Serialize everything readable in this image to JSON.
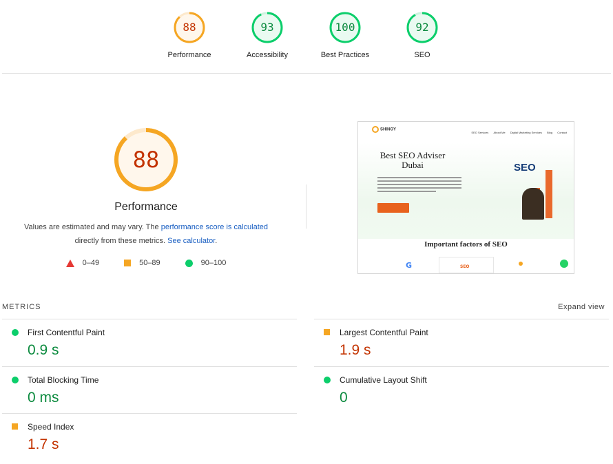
{
  "top_scores": [
    {
      "label": "Performance",
      "score": "88",
      "level": "average"
    },
    {
      "label": "Accessibility",
      "score": "93",
      "level": "good"
    },
    {
      "label": "Best Practices",
      "score": "100",
      "level": "good"
    },
    {
      "label": "SEO",
      "score": "92",
      "level": "good"
    }
  ],
  "performance": {
    "score": "88",
    "title": "Performance",
    "desc_prefix": "Values are estimated and may vary. The ",
    "desc_link1": "performance score is calculated",
    "desc_middle": "directly from these metrics. ",
    "desc_link2": "See calculator",
    "desc_suffix": "."
  },
  "legend": {
    "poor": "0–49",
    "average": "50–89",
    "good": "90–100"
  },
  "screenshot": {
    "logo_text": "SHINOY",
    "menu": [
      "SEO Services",
      "About Me",
      "Digital Marketing Services",
      "Blog",
      "Contact"
    ],
    "hero_title": "Best SEO Adviser Dubai",
    "seo_graphic": "SEO",
    "section_title": "Important factors of SEO"
  },
  "metrics": {
    "heading": "METRICS",
    "expand": "Expand view",
    "items": [
      {
        "name": "First Contentful Paint",
        "value": "0.9 s",
        "level": "good"
      },
      {
        "name": "Largest Contentful Paint",
        "value": "1.9 s",
        "level": "average"
      },
      {
        "name": "Total Blocking Time",
        "value": "0 ms",
        "level": "good"
      },
      {
        "name": "Cumulative Layout Shift",
        "value": "0",
        "level": "good"
      },
      {
        "name": "Speed Index",
        "value": "1.7 s",
        "level": "average"
      }
    ]
  },
  "colors": {
    "good": "#0cce6b",
    "average": "#f5a623",
    "poor": "#e53935",
    "good_text": "#0b8a3e",
    "average_text": "#c33300",
    "link": "#1a5fc2"
  },
  "icons": {
    "poor": "triangle-icon",
    "average": "square-icon",
    "good": "circle-icon"
  }
}
